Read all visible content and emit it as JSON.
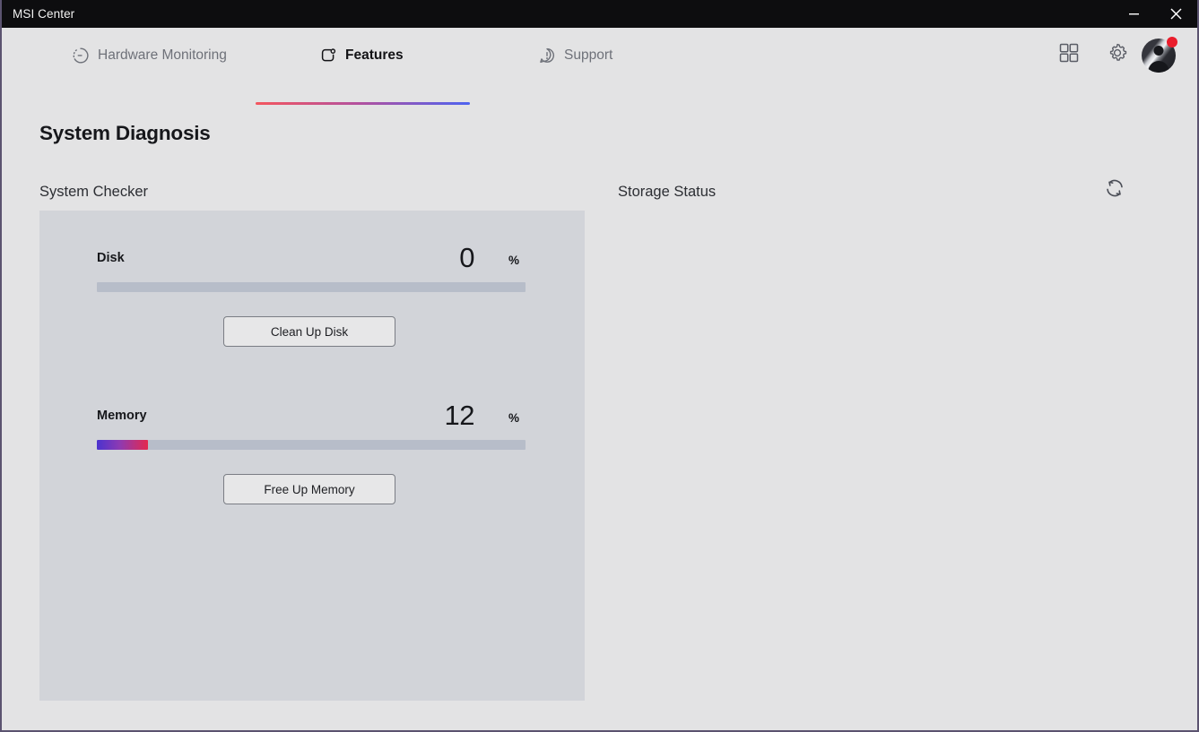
{
  "window": {
    "title": "MSI Center",
    "controls": [
      {
        "name": "minimize-button",
        "label": "Minimize"
      },
      {
        "name": "close-button",
        "label": "Close"
      }
    ]
  },
  "nav": {
    "tabs": [
      {
        "label": "Hardware Monitoring",
        "icon": "gauge-icon",
        "active": false
      },
      {
        "label": "Features",
        "icon": "feature-square-icon",
        "active": true
      },
      {
        "label": "Support",
        "icon": "support-bubble-icon",
        "active": false
      }
    ],
    "icons": [
      {
        "label": "Apps",
        "icon": "grid-apps-icon"
      },
      {
        "label": "Settings",
        "icon": "gear-icon"
      },
      {
        "label": "Account",
        "icon": "user-avatar-icon",
        "badge": true
      }
    ],
    "active_underline_gradient": [
      "#f4565e",
      "#4d63f0"
    ]
  },
  "page": {
    "title": "System Diagnosis"
  },
  "sections": {
    "system_checker": {
      "label": "System Checker",
      "metrics": [
        {
          "name": "Disk",
          "value": "0",
          "unit": "%",
          "percent": 0,
          "button_label": "Clean Up Disk"
        },
        {
          "name": "Memory",
          "value": "12",
          "unit": "%",
          "percent": 12,
          "button_label": "Free Up Memory"
        }
      ]
    },
    "storage_status": {
      "label": "Storage Status",
      "refresh_icon": "refresh-icon",
      "items": []
    }
  },
  "colors": {
    "window_bg": "#e3e3e4",
    "titlebar_bg": "#0d0d0f",
    "card_bg": "#d2d4d9",
    "bar_track": "#b7bdc9",
    "bar_fill_start": "#4b33cf",
    "bar_fill_end": "#e4294e",
    "accent_red": "#f4565e",
    "accent_blue": "#4d63f0",
    "badge_red": "#ea1d2c",
    "text_primary": "#16171b",
    "text_muted": "#6e7179"
  }
}
